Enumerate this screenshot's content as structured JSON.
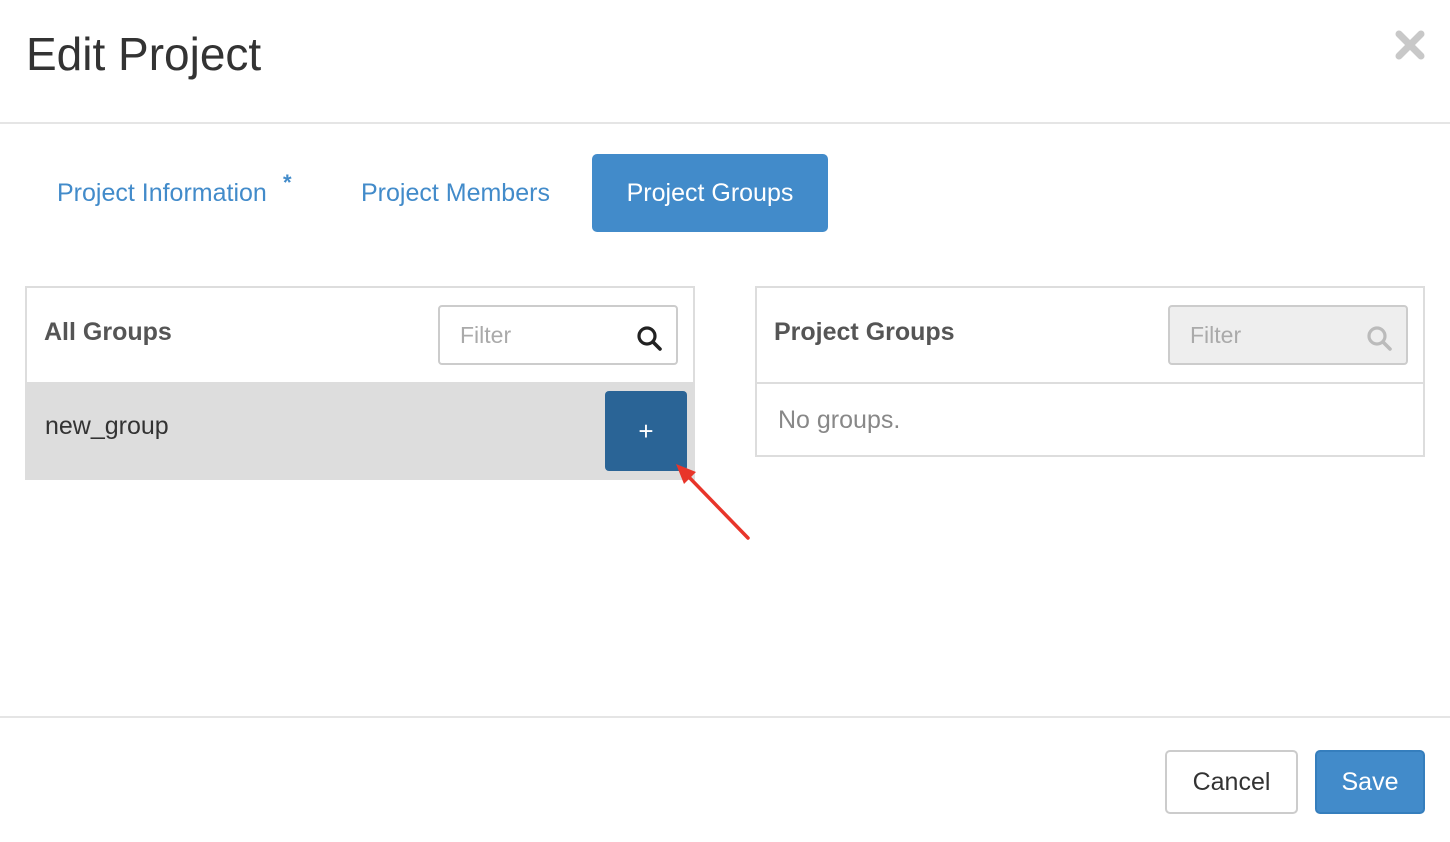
{
  "modal": {
    "title": "Edit Project",
    "close_icon": "close-icon"
  },
  "tabs": [
    {
      "label": "Project Information",
      "required_marker": "*",
      "active": false
    },
    {
      "label": "Project Members",
      "active": false
    },
    {
      "label": "Project Groups",
      "active": true
    }
  ],
  "all_groups": {
    "title": "All Groups",
    "filter_placeholder": "Filter",
    "filter_value": "",
    "search_icon": "search-icon",
    "items": [
      {
        "name": "new_group",
        "action_label": "+"
      }
    ]
  },
  "project_groups": {
    "title": "Project Groups",
    "filter_placeholder": "Filter",
    "filter_value": "",
    "search_icon": "search-icon",
    "empty_message": "No groups."
  },
  "footer": {
    "cancel_label": "Cancel",
    "save_label": "Save"
  },
  "colors": {
    "primary": "#428bca",
    "primary_dark": "#2a6496",
    "row_bg": "#dddddd",
    "annotation": "#e8352a"
  }
}
